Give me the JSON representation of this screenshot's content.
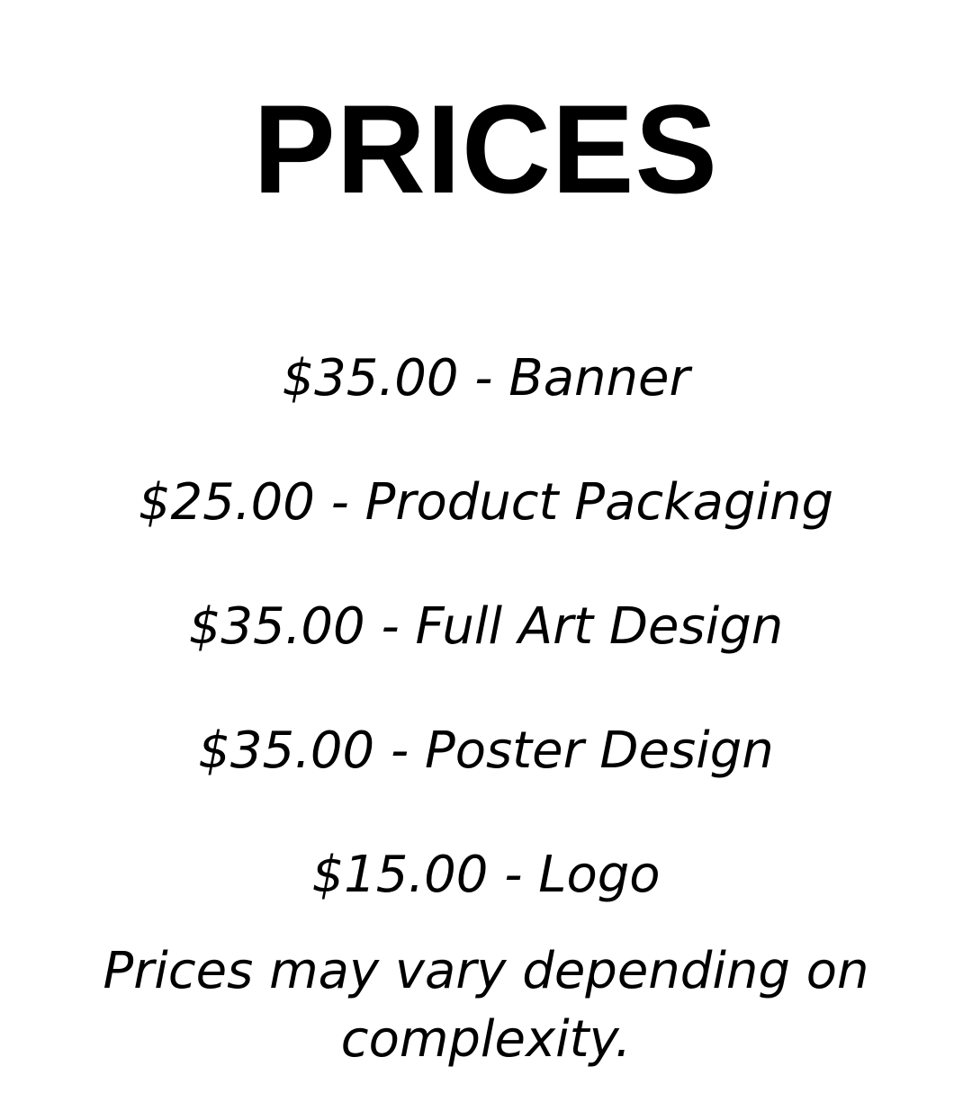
{
  "heading": "PRICES",
  "price_items": [
    {
      "label": "$35.00 - Banner"
    },
    {
      "label": "$25.00 - Product Packaging"
    },
    {
      "label": "$35.00 - Full Art Design"
    },
    {
      "label": "$35.00 - Poster Design"
    },
    {
      "label": "$15.00 - Logo"
    }
  ],
  "note": "Prices may vary depending on complexity."
}
